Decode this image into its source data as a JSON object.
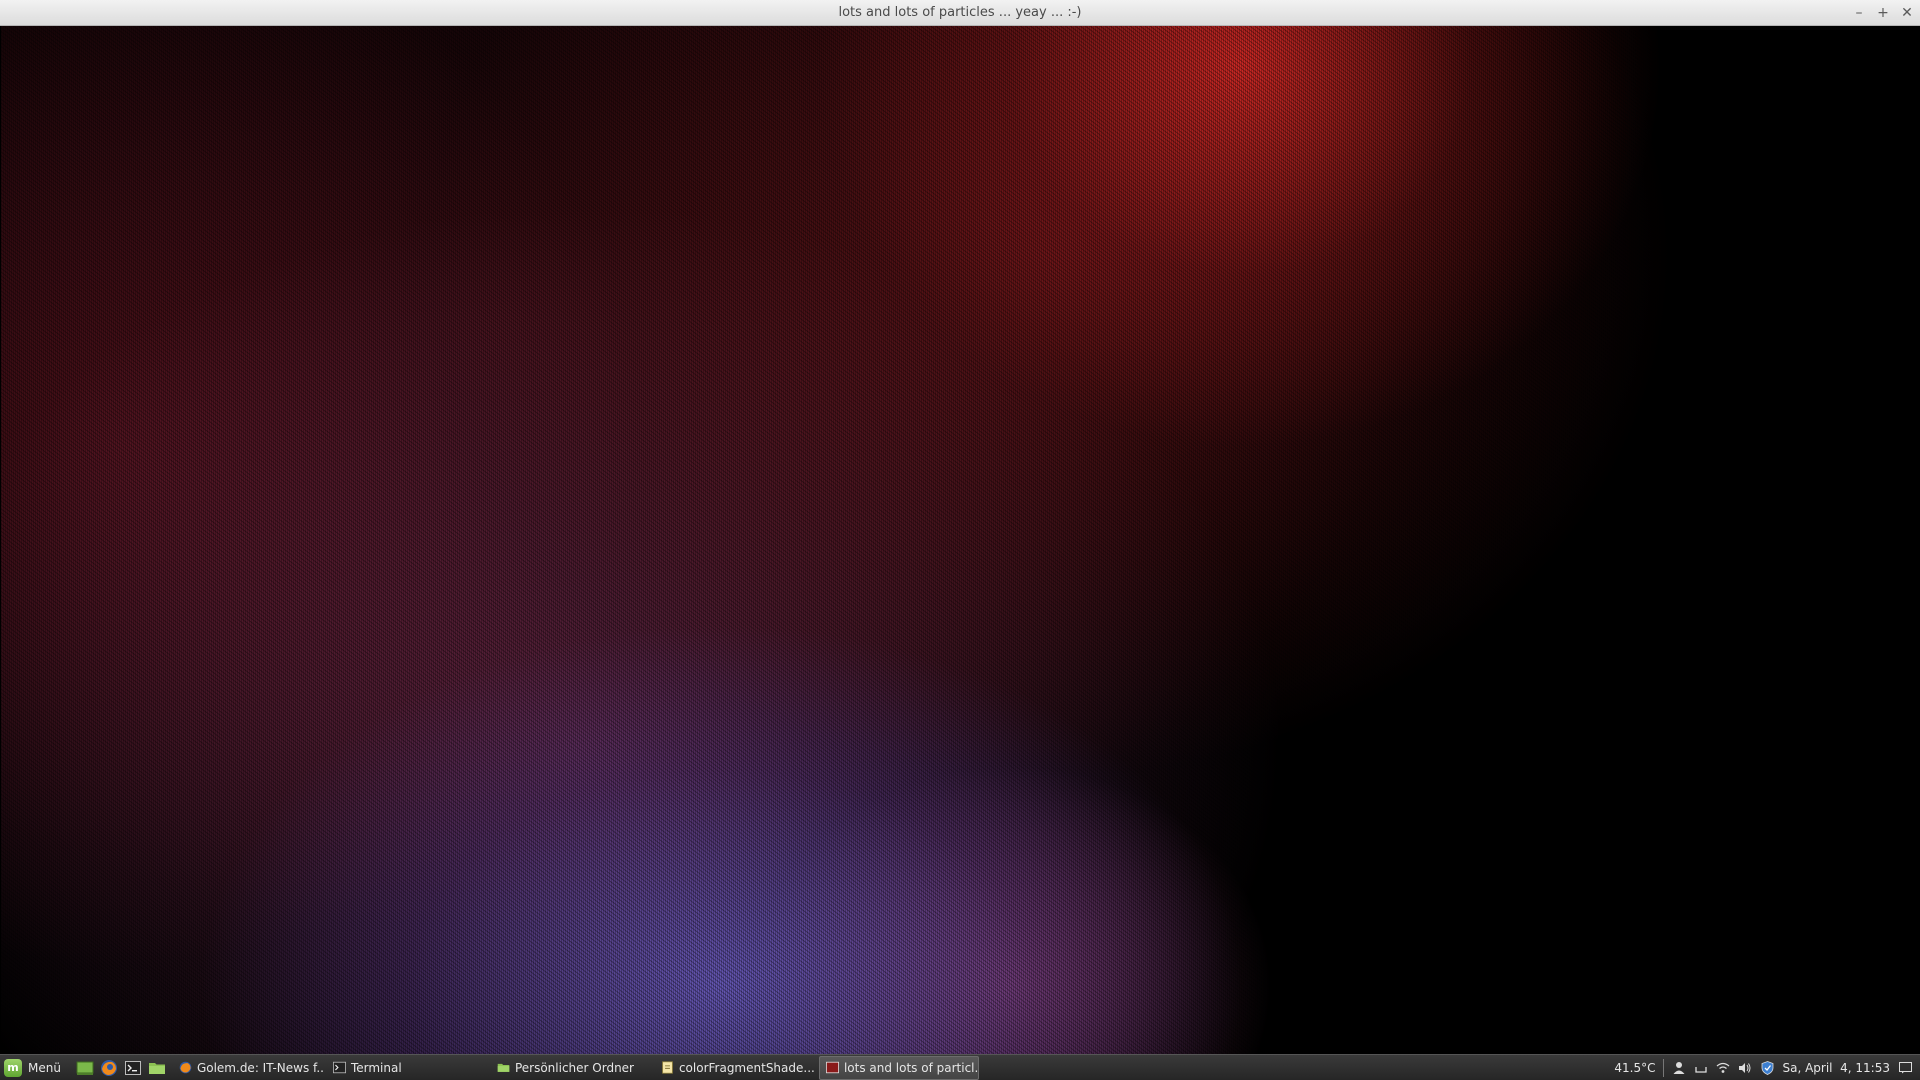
{
  "window": {
    "title": "lots and lots of particles ... yeay ... :-)",
    "buttons": {
      "minimize": "–",
      "maximize": "+",
      "close": "✕"
    }
  },
  "canvas": {
    "description_colors": {
      "background": "#000000",
      "glow_red": "#e62d28",
      "glow_blue": "#786ee6",
      "glow_pink": "#c8508c"
    }
  },
  "taskbar": {
    "menu_label": "Menü",
    "launchers": [
      {
        "icon": "show-desktop-icon"
      },
      {
        "icon": "firefox-icon"
      },
      {
        "icon": "terminal-icon"
      },
      {
        "icon": "folder-icon"
      }
    ],
    "tasks": [
      {
        "label": "Golem.de: IT-News f...",
        "icon": "firefox-icon",
        "active": false
      },
      {
        "label": "Terminal",
        "icon": "terminal-icon",
        "active": false
      },
      {
        "label": "Persönlicher Ordner",
        "icon": "folder-icon",
        "active": false
      },
      {
        "label": "colorFragmentShade...",
        "icon": "editor-icon",
        "active": false
      },
      {
        "label": "lots and lots of particl...",
        "icon": "app-window-icon",
        "active": true
      }
    ],
    "tray": {
      "temperature": "41.5°C",
      "clock": "Sa, April  4, 11:53"
    }
  }
}
